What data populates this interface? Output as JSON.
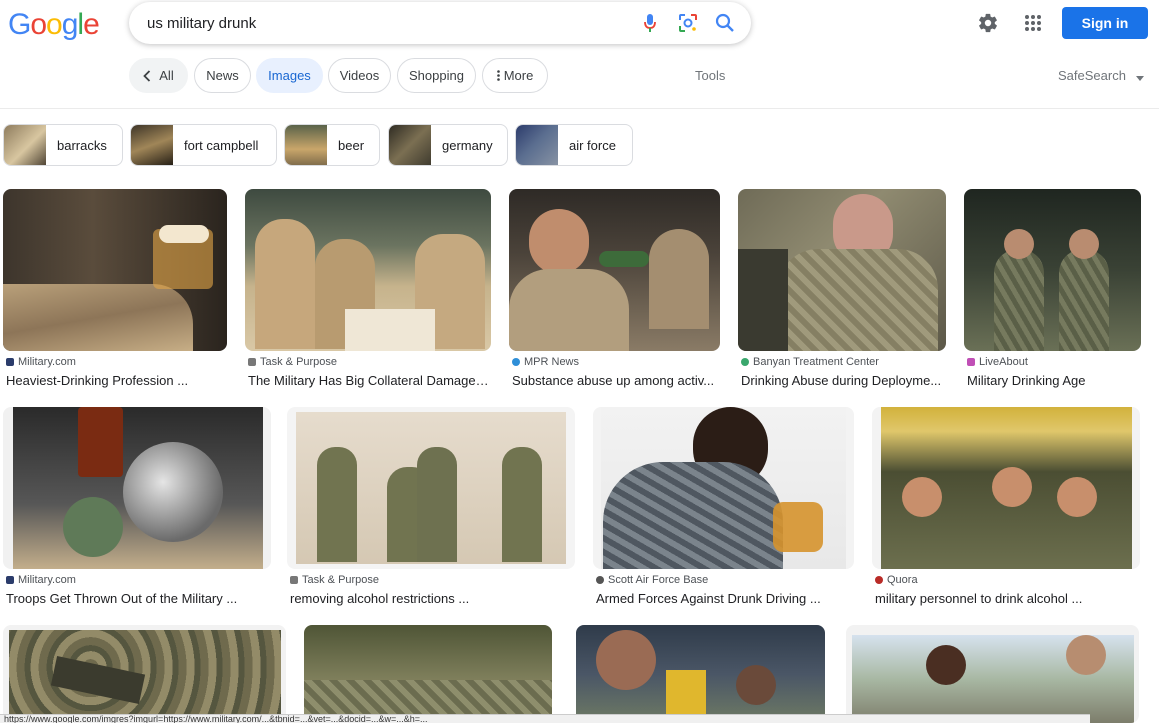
{
  "search": {
    "query": "us military drunk"
  },
  "header": {
    "signin_label": "Sign in"
  },
  "tabs": [
    {
      "label": "All"
    },
    {
      "label": "News"
    },
    {
      "label": "Images"
    },
    {
      "label": "Videos"
    },
    {
      "label": "Shopping"
    },
    {
      "label": "More"
    }
  ],
  "tools_label": "Tools",
  "safesearch_label": "SafeSearch",
  "chips": [
    {
      "label": "barracks"
    },
    {
      "label": "fort campbell"
    },
    {
      "label": "beer"
    },
    {
      "label": "germany"
    },
    {
      "label": "air force"
    }
  ],
  "results": [
    {
      "source": "Military.com",
      "title": "Heaviest-Drinking Profession ..."
    },
    {
      "source": "Task & Purpose",
      "title": "The Military Has Big Collateral Damage ..."
    },
    {
      "source": "MPR News",
      "title": "Substance abuse up among activ..."
    },
    {
      "source": "Banyan Treatment Center",
      "title": "Drinking Abuse during Deployme..."
    },
    {
      "source": "LiveAbout",
      "title": "Military Drinking Age"
    },
    {
      "source": "Military.com",
      "title": "Troops Get Thrown Out of the Military ..."
    },
    {
      "source": "Task & Purpose",
      "title": "removing alcohol restrictions ..."
    },
    {
      "source": "Scott Air Force Base",
      "title": "Armed Forces Against Drunk Driving ..."
    },
    {
      "source": "Quora",
      "title": "military personnel to drink alcohol ..."
    }
  ],
  "status_url": "https://www.google.com/imgres?imgurl=https://www.military.com/...&tbnid=...&vet=...&docid=...&w=...&h=...",
  "colors": {
    "accent": "#1a73e8",
    "active_tab_bg": "#e8f0fe"
  }
}
